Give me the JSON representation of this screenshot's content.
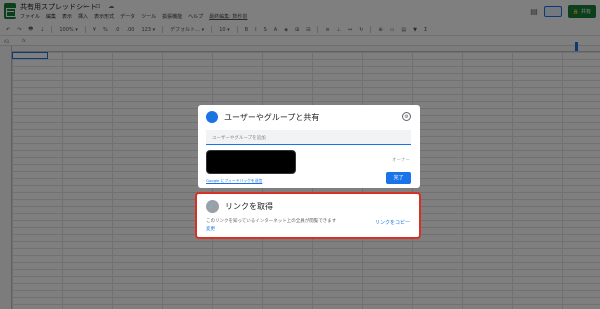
{
  "header": {
    "doc_title": "共有用スプレッドシート",
    "title_icons": "☆ ⊡ ☁",
    "menu": [
      "ファイル",
      "編集",
      "表示",
      "挿入",
      "表示形式",
      "データ",
      "ツール",
      "拡張機能",
      "ヘルプ"
    ],
    "last_edit": "最終編集: 数秒前",
    "share_label": "共有",
    "share_icon": "🔒"
  },
  "toolbar": {
    "items": [
      "↶",
      "↷",
      "🖶",
      "⇣",
      "100% ▾",
      "¥",
      "%",
      ".0",
      ".00",
      "123 ▾",
      "デフォルト… ▾",
      "10 ▾",
      "B",
      "I",
      "S",
      "A",
      "◈",
      "⊞",
      "⊟",
      "≡",
      "⊥",
      "↔",
      "↻",
      "⊕",
      "▭",
      "▤",
      "▼",
      "Σ"
    ]
  },
  "formula_bar": {
    "cell_ref": "A1",
    "fx": "fx"
  },
  "share_dialog": {
    "icon": "👤",
    "title": "ユーザーやグループと共有",
    "settings_icon": "⚙",
    "input_placeholder": "ユーザーやグループを追加",
    "owner_label": "オーナー",
    "feedback_link": "Google にフィードバックを送信",
    "done_label": "完了"
  },
  "link_dialog": {
    "icon": "🔗",
    "title": "リンクを取得",
    "description": "このリンクを知っているインターネット上の全員が閲覧できます",
    "change_label": "変更",
    "copy_label": "リンクをコピー"
  },
  "colors": {
    "accent": "#1a73e8",
    "sheets_green": "#188038",
    "highlight_red": "#d93025",
    "overlay": "rgba(0,0,0,0.5)"
  }
}
